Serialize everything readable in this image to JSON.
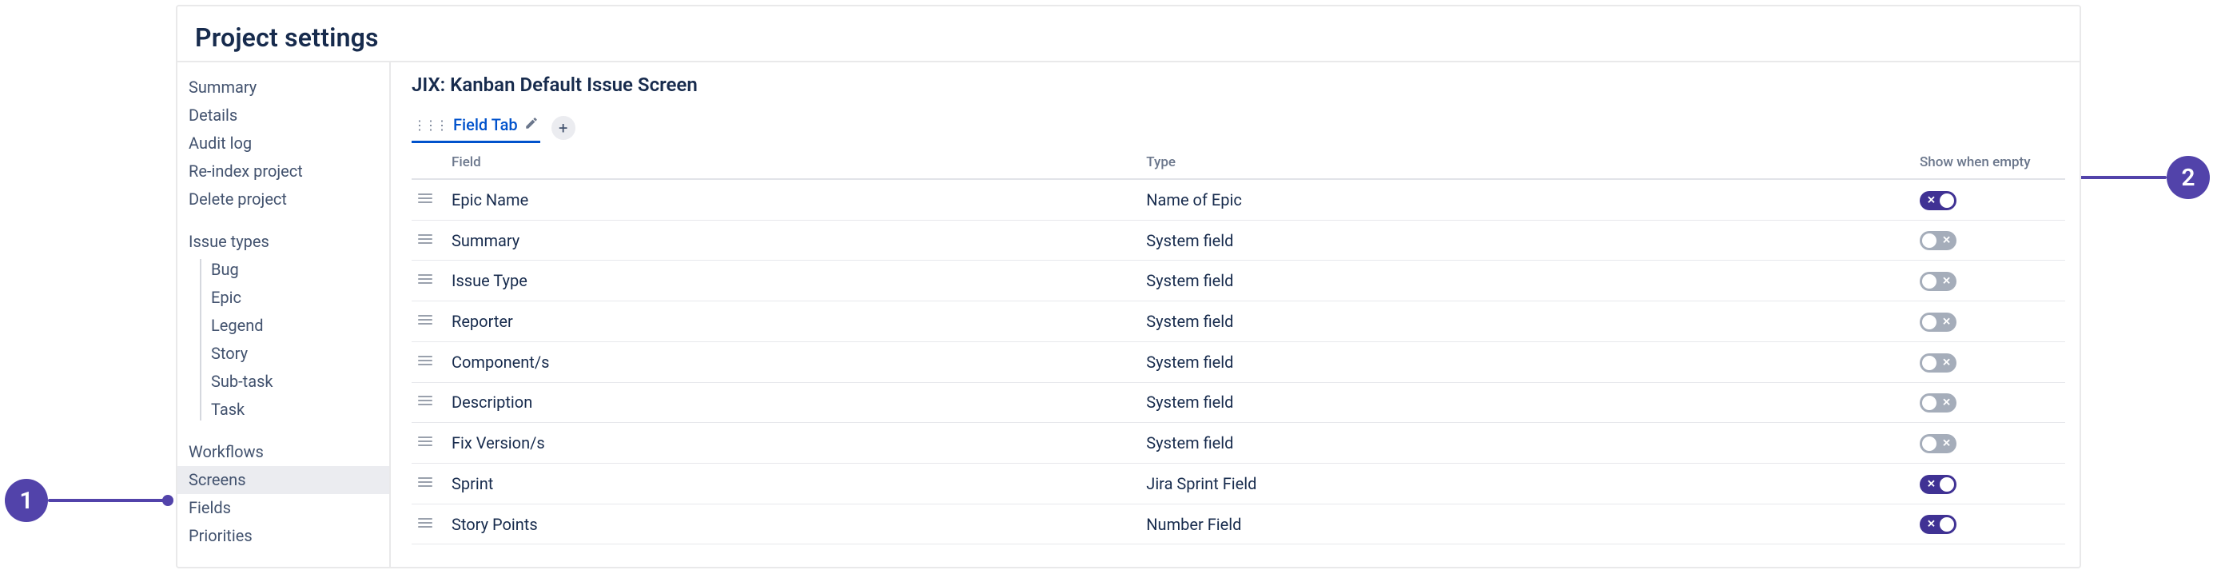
{
  "page": {
    "title": "Project settings"
  },
  "sidebar": {
    "section1": [
      "Summary",
      "Details",
      "Audit log",
      "Re-index project",
      "Delete project"
    ],
    "issue_types_heading": "Issue types",
    "issue_types": [
      "Bug",
      "Epic",
      "Legend",
      "Story",
      "Sub-task",
      "Task"
    ],
    "section3": [
      "Workflows",
      "Screens",
      "Fields",
      "Priorities"
    ],
    "active_item": "Screens"
  },
  "main": {
    "screen_title": "JIX: Kanban Default Issue Screen",
    "tab_label": "Field Tab",
    "columns": {
      "field": "Field",
      "type": "Type",
      "show_when_empty": "Show when empty"
    },
    "rows": [
      {
        "field": "Epic Name",
        "type": "Name of Epic",
        "show_when_empty": true
      },
      {
        "field": "Summary",
        "type": "System field",
        "show_when_empty": false
      },
      {
        "field": "Issue Type",
        "type": "System field",
        "show_when_empty": false
      },
      {
        "field": "Reporter",
        "type": "System field",
        "show_when_empty": false
      },
      {
        "field": "Component/s",
        "type": "System field",
        "show_when_empty": false
      },
      {
        "field": "Description",
        "type": "System field",
        "show_when_empty": false
      },
      {
        "field": "Fix Version/s",
        "type": "System field",
        "show_when_empty": false
      },
      {
        "field": "Sprint",
        "type": "Jira Sprint Field",
        "show_when_empty": true
      },
      {
        "field": "Story Points",
        "type": "Number Field",
        "show_when_empty": true
      }
    ]
  },
  "annotations": {
    "callout1": "1",
    "callout2": "2"
  }
}
